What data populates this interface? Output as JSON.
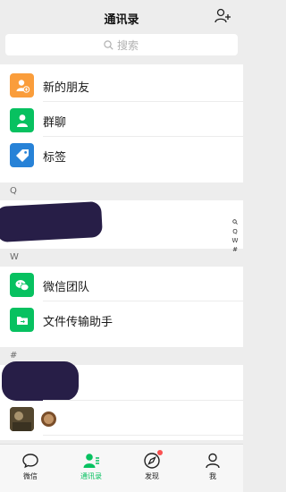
{
  "header": {
    "title": "通讯录",
    "add_friend_icon": "add-friend-icon"
  },
  "search": {
    "placeholder": "搜索"
  },
  "top_items": [
    {
      "label": "新的朋友",
      "color": "#fa9d3b",
      "icon": "new-friends-icon"
    },
    {
      "label": "群聊",
      "color": "#07c160",
      "icon": "group-chat-icon"
    },
    {
      "label": "标签",
      "color": "#2782d7",
      "icon": "tag-icon"
    }
  ],
  "sections": [
    {
      "letter": "Q"
    },
    {
      "letter": "W",
      "items": [
        {
          "label": "微信团队"
        },
        {
          "label": "文件传输助手"
        }
      ]
    },
    {
      "letter": "#"
    }
  ],
  "index_letters": [
    "🔍",
    "Q",
    "W",
    "#"
  ],
  "tabs": [
    {
      "label": "微信",
      "icon": "chat-bubble-icon",
      "active": false
    },
    {
      "label": "通讯录",
      "icon": "contacts-icon",
      "active": true
    },
    {
      "label": "发现",
      "icon": "compass-icon",
      "active": false,
      "badge_dot": true
    },
    {
      "label": "我",
      "icon": "person-icon",
      "active": false
    }
  ],
  "colors": {
    "accent": "#07c160",
    "background": "#ededed",
    "badge": "#fa5151"
  }
}
